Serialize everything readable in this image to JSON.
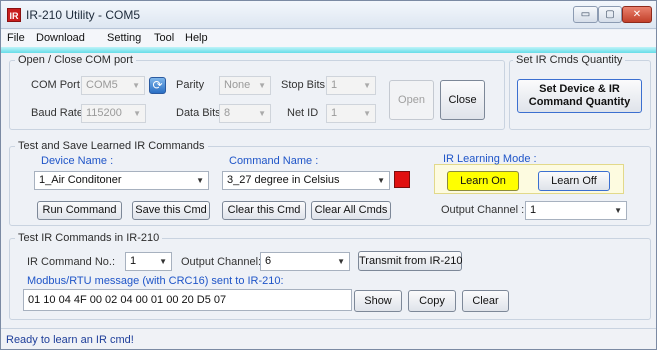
{
  "window": {
    "title": "IR-210 Utility - COM5",
    "icon_label": "IR",
    "controls": {
      "minimize": "▭",
      "maximize": "▢",
      "close": "✕"
    }
  },
  "menu": {
    "file": "File",
    "download": "Download",
    "setting": "Setting",
    "tool": "Tool",
    "help": "Help"
  },
  "com_port": {
    "group_title": "Open / Close COM port",
    "com_port_label": "COM Port",
    "com_port_value": "COM5",
    "parity_label": "Parity",
    "parity_value": "None",
    "stop_bits_label": "Stop Bits",
    "stop_bits_value": "1",
    "baud_rate_label": "Baud Rate",
    "baud_rate_value": "115200",
    "data_bits_label": "Data Bits",
    "data_bits_value": "8",
    "net_id_label": "Net ID",
    "net_id_value": "1",
    "open_label": "Open",
    "close_label": "Close"
  },
  "quantity": {
    "group_title": "Set IR Cmds Quantity",
    "button_line1": "Set Device & IR",
    "button_line2": "Command Quantity"
  },
  "learn": {
    "group_title": "Test and Save Learned IR Commands",
    "device_name_label": "Device Name :",
    "device_name_value": "1_Air Conditoner",
    "command_name_label": "Command Name :",
    "command_name_value": "3_27 degree in Celsius",
    "learning_mode_label": "IR Learning Mode :",
    "learn_on_label": "Learn On",
    "learn_off_label": "Learn Off",
    "run_command_label": "Run Command",
    "save_cmd_label": "Save this Cmd",
    "clear_cmd_label": "Clear this Cmd",
    "clear_all_label": "Clear All Cmds",
    "output_channel_label": "Output Channel :",
    "output_channel_value": "1",
    "indicator_color": "#e01010"
  },
  "test": {
    "group_title": "Test IR Commands in IR-210",
    "ir_command_no_label": "IR Command No.:",
    "ir_command_no_value": "1",
    "output_channel_label": "Output Channel:",
    "output_channel_value": "6",
    "transmit_label": "Transmit from IR-210",
    "modbus_label": "Modbus/RTU message (with CRC16) sent to IR-210:",
    "modbus_value": "01 10 04 4F 00 02 04 00 01 00 20 D5 07",
    "show_label": "Show",
    "copy_label": "Copy",
    "clear_label": "Clear"
  },
  "status": {
    "text": "Ready to learn an IR cmd!"
  },
  "colors": {
    "accent": "#66dde8",
    "learn_on": "#ffff00",
    "label_blue": "#1f55c8"
  }
}
